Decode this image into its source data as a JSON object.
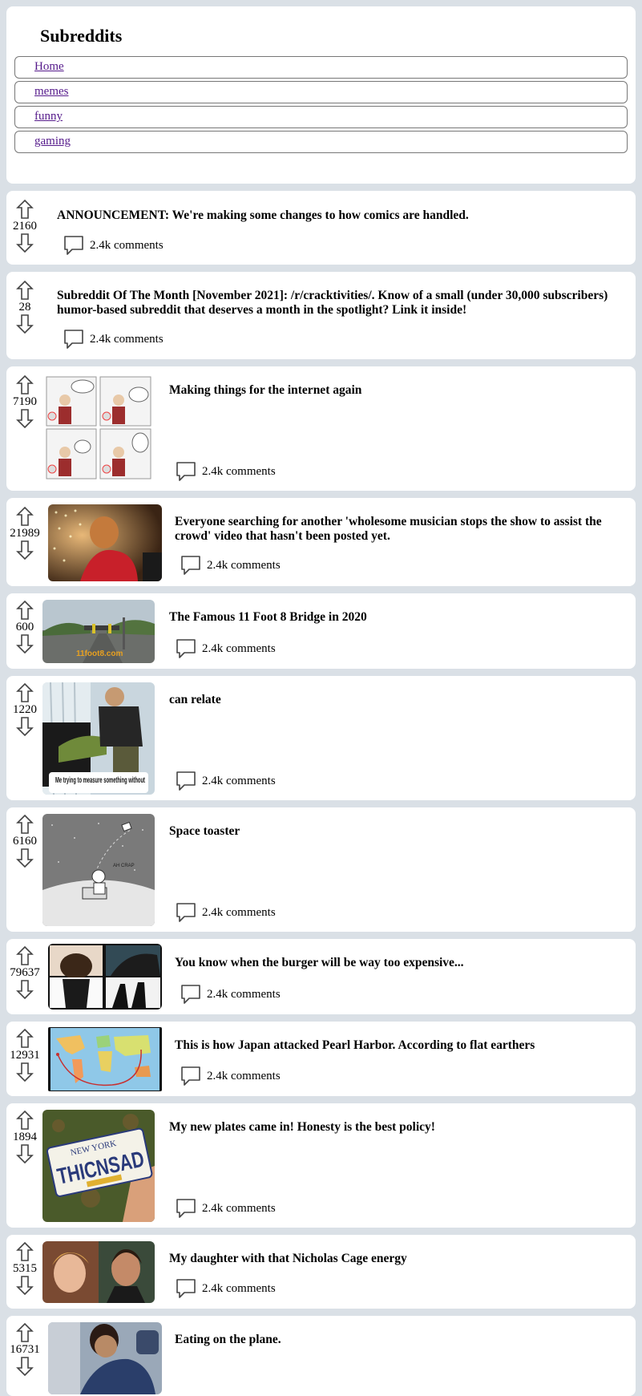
{
  "subreddits": {
    "heading": "Subreddits",
    "items": [
      "Home",
      "memes",
      "funny",
      "gaming"
    ]
  },
  "comment_label": "2.4k comments",
  "posts": [
    {
      "score": "2160",
      "title": "ANNOUNCEMENT: We're making some changes to how comics are handled."
    },
    {
      "score": "28",
      "title": "Subreddit Of The Month [November 2021]: /r/cracktivities/. Know of a small (under 30,000 subscribers) humor-based subreddit that deserves a month in the spotlight? Link it inside!"
    },
    {
      "score": "7190",
      "title": "Making things for the internet again"
    },
    {
      "score": "21989",
      "title": "Everyone searching for another 'wholesome musician stops the show to assist the crowd' video that hasn't been posted yet."
    },
    {
      "score": "600",
      "title": "The Famous 11 Foot 8 Bridge in 2020",
      "image_text": "11foot8.com"
    },
    {
      "score": "1220",
      "title": "can relate",
      "image_text": "Me trying to measure something without"
    },
    {
      "score": "6160",
      "title": "Space toaster",
      "image_text": "AH CRAP"
    },
    {
      "score": "79637",
      "title": "You know when the burger will be way too expensive..."
    },
    {
      "score": "12931",
      "title": "This is how Japan attacked Pearl Harbor. According to flat earthers"
    },
    {
      "score": "1894",
      "title": "My new plates came in! Honesty is the best policy!",
      "image_text": "THICNSAD",
      "image_text_2": "NEW YORK"
    },
    {
      "score": "5315",
      "title": "My daughter with that Nicholas Cage energy"
    },
    {
      "score": "16731",
      "title": "Eating on the plane."
    }
  ]
}
